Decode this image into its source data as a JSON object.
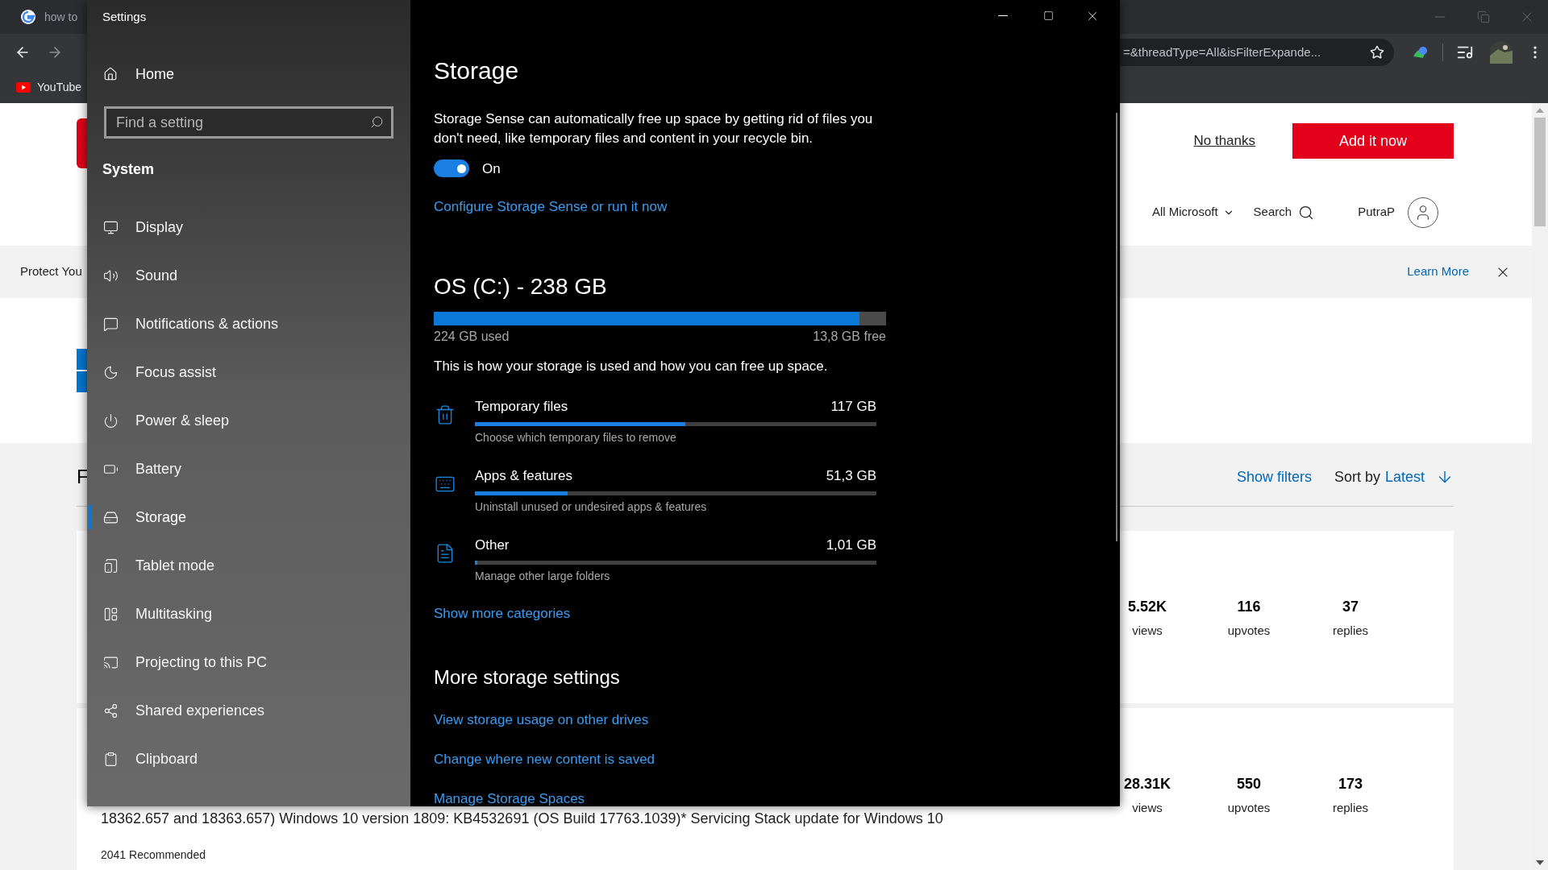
{
  "browser": {
    "tab": {
      "title": "how to"
    },
    "address_bar": {
      "value": "=&threadType=All&isFilterExpande..."
    },
    "bookmarks": [
      {
        "label": "YouTube"
      }
    ]
  },
  "page": {
    "banner": {
      "decline": "No thanks",
      "accept": "Add it now"
    },
    "header": {
      "menu": "All Microsoft",
      "search": "Search",
      "user": "PutraP"
    },
    "notice": {
      "text": "Protect You",
      "link": "Learn More"
    },
    "section_heading": "F",
    "filters": {
      "show": "Show filters",
      "sort_label": "Sort by",
      "sort_value": "Latest"
    },
    "threads": [
      {
        "stats": [
          {
            "value": "5.52K",
            "label": "views"
          },
          {
            "value": "116",
            "label": "upvotes"
          },
          {
            "value": "37",
            "label": "replies"
          }
        ]
      },
      {
        "text": "18362.657 and 18363.657) Windows 10 version 1809: KB4532691 (OS Build 17763.1039)* Servicing Stack update for Windows 10",
        "recommended": "2041 Recommended",
        "stats": [
          {
            "value": "28.31K",
            "label": "views"
          },
          {
            "value": "550",
            "label": "upvotes"
          },
          {
            "value": "173",
            "label": "replies"
          }
        ]
      }
    ]
  },
  "settings": {
    "window": {
      "title": "Settings"
    },
    "sidebar": {
      "home": "Home",
      "search": {
        "placeholder": "Find a setting"
      },
      "section": "System",
      "items": [
        {
          "label": "Display",
          "selected": false
        },
        {
          "label": "Sound",
          "selected": false
        },
        {
          "label": "Notifications & actions",
          "selected": false
        },
        {
          "label": "Focus assist",
          "selected": false
        },
        {
          "label": "Power & sleep",
          "selected": false
        },
        {
          "label": "Battery",
          "selected": false
        },
        {
          "label": "Storage",
          "selected": true
        },
        {
          "label": "Tablet mode",
          "selected": false
        },
        {
          "label": "Multitasking",
          "selected": false
        },
        {
          "label": "Projecting to this PC",
          "selected": false
        },
        {
          "label": "Shared experiences",
          "selected": false
        },
        {
          "label": "Clipboard",
          "selected": false
        }
      ]
    },
    "content": {
      "title": "Storage",
      "description": "Storage Sense can automatically free up space by getting rid of files you don't need, like temporary files and content in your recycle bin.",
      "storage_sense": {
        "on": true,
        "label": "On"
      },
      "configure_link": "Configure Storage Sense or run it now",
      "drive": {
        "title": "OS (C:) - 238 GB",
        "level": 0.942,
        "used": "224 GB used",
        "free": "13,8 GB free"
      },
      "usage_intro": "This is how your storage is used and how you can free up space.",
      "categories": [
        {
          "name": "Temporary files",
          "size": "117 GB",
          "description": "Choose which temporary files to remove",
          "level": 0.525
        },
        {
          "name": "Apps & features",
          "size": "51,3 GB",
          "description": "Uninstall unused or undesired apps & features",
          "level": 0.23
        },
        {
          "name": "Other",
          "size": "1,01 GB",
          "description": "Manage other large folders",
          "level": 0.006
        }
      ],
      "more_categories_link": "Show more categories",
      "more_settings": {
        "title": "More storage settings",
        "links": [
          "View storage usage on other drives",
          "Change where new content is saved",
          "Manage Storage Spaces"
        ]
      }
    }
  }
}
